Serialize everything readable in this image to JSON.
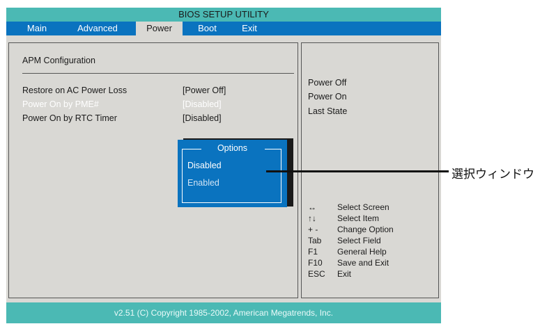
{
  "title": "BIOS SETUP UTILITY",
  "menu": [
    "Main",
    "Advanced",
    "Power",
    "Boot",
    "Exit"
  ],
  "active_menu": "Power",
  "section_title": "APM Configuration",
  "settings": [
    {
      "label": "Restore on AC Power Loss",
      "value": "[Power Off]"
    },
    {
      "label": "Power On by PME#",
      "value": "[Disabled]"
    },
    {
      "label": "Power On by RTC Timer",
      "value": "[Disabled]"
    }
  ],
  "help_options": [
    "Power Off",
    "Power On",
    "Last State"
  ],
  "popup": {
    "title": "Options",
    "options": [
      "Disabled",
      "Enabled"
    ],
    "selected": "Disabled"
  },
  "key_legend": [
    {
      "key": "↔",
      "desc": "Select Screen"
    },
    {
      "key": "↑↓",
      "desc": "Select Item"
    },
    {
      "key": "+ -",
      "desc": "Change Option"
    },
    {
      "key": "Tab",
      "desc": "Select Field"
    },
    {
      "key": "F1",
      "desc": "General Help"
    },
    {
      "key": "F10",
      "desc": "Save and Exit"
    },
    {
      "key": "ESC",
      "desc": "Exit"
    }
  ],
  "footer": "v2.51 (C) Copyright 1985-2002, American Megatrends, Inc.",
  "callout_label": "選択ウィンドウ",
  "colors": {
    "title_bar": "#4bb9b4",
    "menu_bar": "#0a73bf",
    "panel_bg": "#d9d8d4",
    "popup_bg": "#0a73bf",
    "highlight_text": "#ffffff"
  }
}
